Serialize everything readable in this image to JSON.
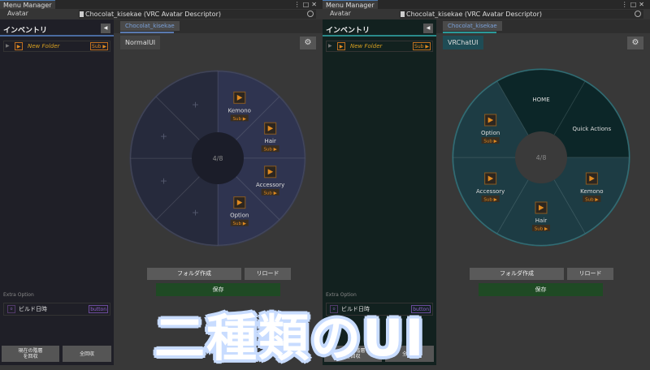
{
  "windows": [
    {
      "title": "Menu Manager",
      "avatar_label": "Avatar",
      "avatar_value": "Chocolat_kisekae (VRC Avatar Descriptor)",
      "sidebar": {
        "title": "インベントリ",
        "folder": {
          "name": "New Folder",
          "sub": "Sub ▶"
        },
        "extra_label": "Extra Option",
        "build": {
          "icon": "o",
          "label": "ビルド日時",
          "button": "button"
        },
        "bottom_buttons": [
          "現在の階層\nを回収",
          "全回収"
        ]
      },
      "main": {
        "tab": "Chocolat_kisekae",
        "ui_button": "NormalUI",
        "folder_create": "フォルダ作成",
        "reload": "リロード",
        "save": "保存",
        "wheel": {
          "center": "4/8",
          "items": [
            {
              "label": "Kemono",
              "sub": "Sub ▶"
            },
            {
              "label": "Hair",
              "sub": "Sub ▶"
            },
            {
              "label": "Accessory",
              "sub": "Sub ▶"
            },
            {
              "label": "Option",
              "sub": "Sub ▶"
            }
          ],
          "empty_slots": 4
        }
      }
    },
    {
      "title": "Menu Manager",
      "avatar_label": "Avatar",
      "avatar_value": "Chocolat_kisekae (VRC Avatar Descriptor)",
      "sidebar": {
        "title": "インベントリ",
        "folder": {
          "name": "New Folder",
          "sub": "Sub ▶"
        },
        "extra_label": "Extra Option",
        "build": {
          "icon": "o",
          "label": "ビルド日時",
          "button": "button"
        },
        "bottom_buttons": [
          "現在の階層\nを回収",
          "全回収"
        ]
      },
      "main": {
        "tab": "Chocolat_kisekae",
        "ui_button": "VRChatUI",
        "folder_create": "フォルダ作成",
        "reload": "リロード",
        "save": "保存",
        "wheel": {
          "center": "4/8",
          "fixed": [
            "HOME",
            "Quick Actions"
          ],
          "items": [
            {
              "label": "Kemono",
              "sub": "Sub ▶"
            },
            {
              "label": "Hair",
              "sub": "Sub ▶"
            },
            {
              "label": "Accessory",
              "sub": "Sub ▶"
            },
            {
              "label": "Option",
              "sub": "Sub ▶"
            }
          ]
        }
      }
    }
  ],
  "overlay_title": "二種類のUI",
  "colors": {
    "accent_orange": "#e08a20",
    "save_green": "#1f4a24",
    "normal_wheel": "#2a2d40",
    "vrchat_wheel": "#1d3c44"
  }
}
